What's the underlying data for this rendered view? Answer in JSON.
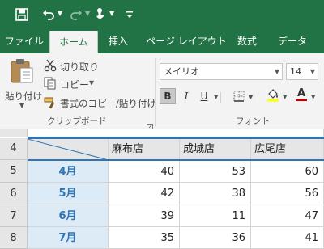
{
  "qat": {
    "save_icon": "save-icon",
    "undo_icon": "undo-icon",
    "redo_icon": "redo-icon",
    "touch_icon": "touch-mode-icon",
    "customize_icon": "customize-qat-icon"
  },
  "tabs": [
    {
      "label": "ファイル"
    },
    {
      "label": "ホーム"
    },
    {
      "label": "挿入"
    },
    {
      "label": "ページ レイアウト"
    },
    {
      "label": "数式"
    },
    {
      "label": "データ"
    }
  ],
  "clipboard": {
    "paste_label": "貼り付け",
    "cut_label": "切り取り",
    "copy_label": "コピー",
    "format_painter_label": "書式のコピー/貼り付け",
    "group_label": "クリップボード"
  },
  "font": {
    "font_name": "メイリオ",
    "font_size": "14",
    "bold": "B",
    "italic": "I",
    "underline": "U",
    "font_color_letter": "A",
    "group_label": "フォント",
    "fill_color": "#ffff00",
    "text_color": "#c00000"
  },
  "sheet": {
    "rows": [
      {
        "num": "4",
        "month": "",
        "values": [
          "麻布店",
          "成城店",
          "広尾店"
        ]
      },
      {
        "num": "5",
        "month": "4月",
        "values": [
          "40",
          "53",
          "60"
        ]
      },
      {
        "num": "6",
        "month": "5月",
        "values": [
          "42",
          "38",
          "56"
        ]
      },
      {
        "num": "7",
        "month": "6月",
        "values": [
          "39",
          "11",
          "47"
        ]
      },
      {
        "num": "8",
        "month": "7月",
        "values": [
          "35",
          "36",
          "41"
        ]
      }
    ]
  }
}
